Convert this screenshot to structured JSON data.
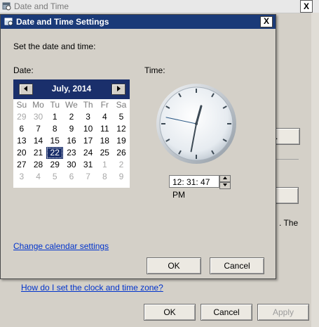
{
  "parent": {
    "title": "Date and Time",
    "close_label": "X",
    "change_button_label": "ne...",
    "right_text": ". The",
    "help_link": "How do I set the clock and time zone?",
    "ok_label": "OK",
    "cancel_label": "Cancel",
    "apply_label": "Apply"
  },
  "dialog": {
    "title": "Date and Time Settings",
    "close_label": "X",
    "instruction": "Set the date and time:",
    "date_label": "Date:",
    "time_label": "Time:",
    "calendar_settings_link": "Change calendar settings",
    "ok_label": "OK",
    "cancel_label": "Cancel"
  },
  "calendar": {
    "month_label": "July, 2014",
    "weekdays": [
      "Su",
      "Mo",
      "Tu",
      "We",
      "Th",
      "Fr",
      "Sa"
    ],
    "weeks": [
      [
        {
          "d": "29",
          "other": true
        },
        {
          "d": "30",
          "other": true
        },
        {
          "d": "1"
        },
        {
          "d": "2"
        },
        {
          "d": "3"
        },
        {
          "d": "4"
        },
        {
          "d": "5"
        }
      ],
      [
        {
          "d": "6"
        },
        {
          "d": "7"
        },
        {
          "d": "8"
        },
        {
          "d": "9"
        },
        {
          "d": "10"
        },
        {
          "d": "11"
        },
        {
          "d": "12"
        }
      ],
      [
        {
          "d": "13"
        },
        {
          "d": "14"
        },
        {
          "d": "15"
        },
        {
          "d": "16"
        },
        {
          "d": "17"
        },
        {
          "d": "18"
        },
        {
          "d": "19"
        }
      ],
      [
        {
          "d": "20"
        },
        {
          "d": "21"
        },
        {
          "d": "22",
          "selected": true
        },
        {
          "d": "23"
        },
        {
          "d": "24"
        },
        {
          "d": "25"
        },
        {
          "d": "26"
        }
      ],
      [
        {
          "d": "27"
        },
        {
          "d": "28"
        },
        {
          "d": "29"
        },
        {
          "d": "30"
        },
        {
          "d": "31"
        },
        {
          "d": "1",
          "other": true
        },
        {
          "d": "2",
          "other": true
        }
      ],
      [
        {
          "d": "3",
          "other": true
        },
        {
          "d": "4",
          "other": true
        },
        {
          "d": "5",
          "other": true
        },
        {
          "d": "6",
          "other": true
        },
        {
          "d": "7",
          "other": true
        },
        {
          "d": "8",
          "other": true
        },
        {
          "d": "9",
          "other": true
        }
      ]
    ]
  },
  "clock": {
    "hours": 12,
    "minutes": 31,
    "seconds": 47
  },
  "time_input": {
    "value": "12: 31: 47 PM"
  },
  "colors": {
    "titlebar": "#1a3a78",
    "calendar_header": "#1a2f6b",
    "link": "#0033cc"
  }
}
